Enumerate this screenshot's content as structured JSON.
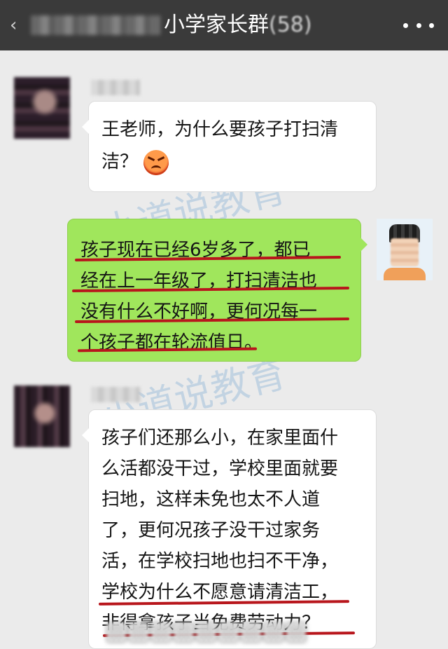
{
  "header": {
    "title": "小学家长群",
    "member_count": "(58)"
  },
  "messages": [
    {
      "side": "left",
      "lines": [
        "王老师，为什么要孩子打扫清",
        "洁？"
      ],
      "emoji": "angry-face"
    },
    {
      "side": "right",
      "lines": [
        "孩子现在已经6岁多了，都已",
        "经在上一年级了，打扫清洁也",
        "没有什么不好啊，更何况每一",
        "个孩子都在轮流值日。"
      ]
    },
    {
      "side": "left",
      "lines": [
        "孩子们还那么小，在家里面什",
        "么活都没干过，学校里面就要",
        "扫地，这样未免也太不人道",
        "了，更何况孩子没干过家务",
        "活，在学校扫地也扫不干净，",
        "学校为什么不愿意请清洁工，",
        "非得拿孩子当免费劳动力？"
      ]
    }
  ],
  "watermark": "小道说教育",
  "colors": {
    "header_bg": "#3a3a3a",
    "chat_bg": "#ebebeb",
    "bubble_self": "#a0e65c",
    "bubble_other": "#ffffff",
    "underline": "#b8161c",
    "watermark": "#5a96cd"
  },
  "icons": [
    "back-icon",
    "more-icon",
    "angry-face-emoji"
  ]
}
